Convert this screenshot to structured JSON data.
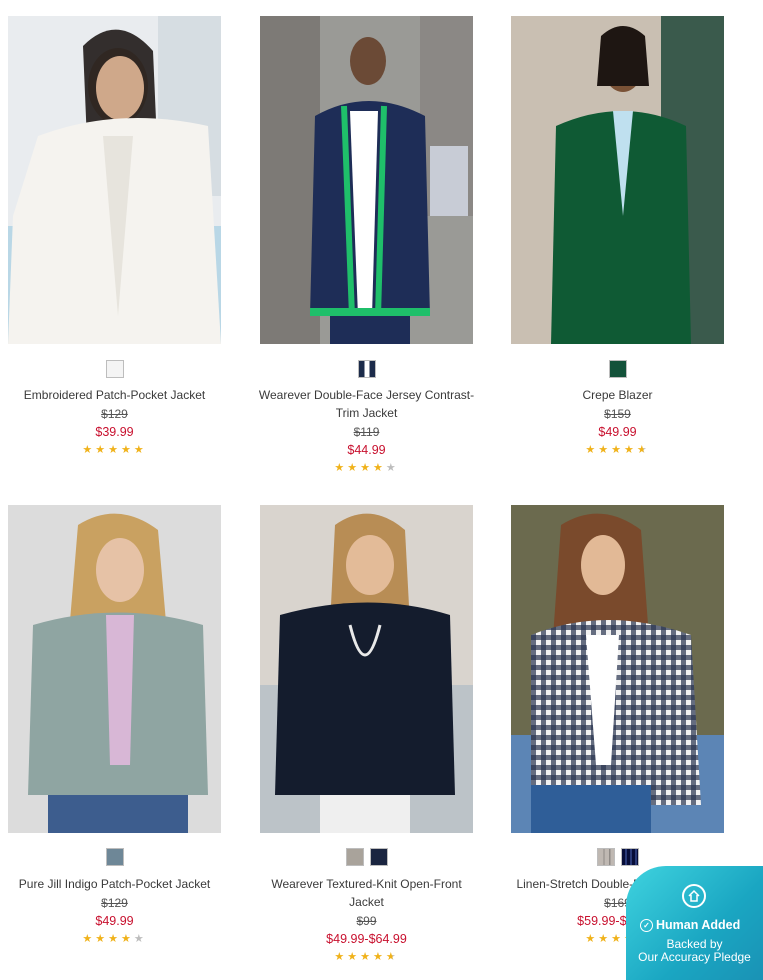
{
  "products": [
    {
      "name": "Embroidered Patch-Pocket Jacket",
      "name2": "",
      "orig": "$129",
      "sale": "$39.99",
      "stars": [
        "on",
        "on",
        "on",
        "on",
        "on"
      ],
      "swatches": [
        "#f4f4f4"
      ],
      "image": "woman in white embroidered jacket"
    },
    {
      "name": "Wearever Double-Face Jersey Contrast-",
      "name2": "Trim Jacket",
      "orig": "$119",
      "sale": "$44.99",
      "stars": [
        "on",
        "on",
        "on",
        "on",
        "off"
      ],
      "swatches": [
        "#1c2b4a"
      ],
      "image": "woman in navy jacket with green trim"
    },
    {
      "name": "Crepe Blazer",
      "name2": "",
      "orig": "$159",
      "sale": "$49.99",
      "stars": [
        "on",
        "on",
        "on",
        "on",
        "half"
      ],
      "swatches": [
        "#13523a"
      ],
      "image": "woman in green blazer"
    },
    {
      "name": "Pure Jill Indigo Patch-Pocket Jacket",
      "name2": "",
      "orig": "$129",
      "sale": "$49.99",
      "stars": [
        "on",
        "on",
        "on",
        "on",
        "off"
      ],
      "swatches": [
        "#6e8797"
      ],
      "image": "woman in sage cropped jacket"
    },
    {
      "name": "Wearever Textured-Knit Open-Front",
      "name2": "Jacket",
      "orig": "$99",
      "sale": "$49.99-$64.99",
      "stars": [
        "on",
        "on",
        "on",
        "on",
        "half"
      ],
      "swatches": [
        "#a9a39b",
        "#1a2540"
      ],
      "image": "woman in black open-front cardigan"
    },
    {
      "name": "Linen-Stretch Double-Breasted Blazer",
      "name2": "",
      "orig": "$169",
      "sale": "$59.99-$89.99",
      "stars": [
        "on",
        "on",
        "on",
        "on",
        "on"
      ],
      "swatches": [
        "#bfb8b2",
        "#2a3a78"
      ],
      "image": "woman in gingham blazer"
    }
  ],
  "badge": {
    "title": "Human Added",
    "line1": "Backed by",
    "line2": "Our Accuracy Pledge"
  },
  "icons": {
    "star": "star-icon",
    "badge": "home-icon",
    "check": "check-icon"
  }
}
